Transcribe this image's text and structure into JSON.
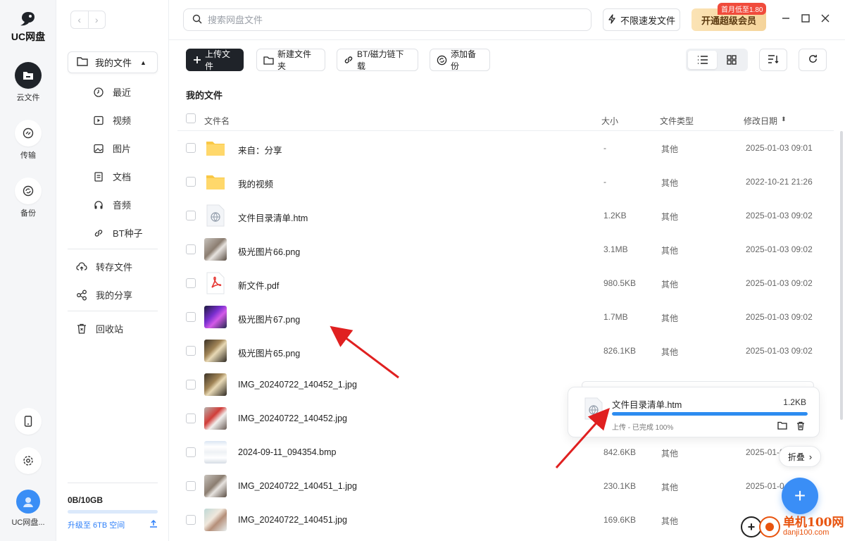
{
  "app": {
    "name": "UC网盘"
  },
  "rail": {
    "items": [
      {
        "label": "云文件"
      },
      {
        "label": "传输"
      },
      {
        "label": "备份"
      }
    ],
    "user_label": "UC网盘..."
  },
  "sidebar": {
    "my_files": "我的文件",
    "categories": [
      {
        "label": "最近"
      },
      {
        "label": "视频"
      },
      {
        "label": "图片"
      },
      {
        "label": "文档"
      },
      {
        "label": "音频"
      },
      {
        "label": "BT种子"
      }
    ],
    "transfer": "转存文件",
    "share": "我的分享",
    "recycle": "回收站",
    "storage": {
      "used": "0B/10GB",
      "upgrade": "升级至 6TB 空间"
    }
  },
  "topbar": {
    "search_placeholder": "搜索网盘文件",
    "fast_download": "不限速发文件",
    "vip_button": "开通超级会员",
    "vip_badge": "首月低至1.80"
  },
  "toolbar": {
    "upload": "上传文件",
    "new_folder": "新建文件夹",
    "bt_magnet": "BT/磁力链下载",
    "add_backup": "添加备份"
  },
  "page_title": "我的文件",
  "table": {
    "headers": {
      "name": "文件名",
      "size": "大小",
      "type": "文件类型",
      "date": "修改日期"
    },
    "rows": [
      {
        "name": "来自：分享",
        "size": "-",
        "type": "其他",
        "date": "2025-01-03 09:01",
        "kind": "folder"
      },
      {
        "name": "我的视频",
        "size": "-",
        "type": "其他",
        "date": "2022-10-21 21:26",
        "kind": "folder"
      },
      {
        "name": "文件目录清单.htm",
        "size": "1.2KB",
        "type": "其他",
        "date": "2025-01-03 09:02",
        "kind": "htm"
      },
      {
        "name": "极光图片66.png",
        "size": "3.1MB",
        "type": "其他",
        "date": "2025-01-03 09:02",
        "kind": "photo-a"
      },
      {
        "name": "新文件.pdf",
        "size": "980.5KB",
        "type": "其他",
        "date": "2025-01-03 09:02",
        "kind": "pdf"
      },
      {
        "name": "极光图片67.png",
        "size": "1.7MB",
        "type": "其他",
        "date": "2025-01-03 09:02",
        "kind": "photo-b"
      },
      {
        "name": "极光图片65.png",
        "size": "826.1KB",
        "type": "其他",
        "date": "2025-01-03 09:02",
        "kind": "photo-c"
      },
      {
        "name": "IMG_20240722_140452_1.jpg",
        "size": "",
        "type": "",
        "date": "",
        "kind": "photo-c"
      },
      {
        "name": "IMG_20240722_140452.jpg",
        "size": "",
        "type": "",
        "date": "",
        "kind": "photo-d"
      },
      {
        "name": "2024-09-11_094354.bmp",
        "size": "842.6KB",
        "type": "其他",
        "date": "2025-01-0",
        "kind": "screenshot"
      },
      {
        "name": "IMG_20240722_140451_1.jpg",
        "size": "230.1KB",
        "type": "其他",
        "date": "2025-01-0",
        "kind": "photo-a"
      },
      {
        "name": "IMG_20240722_140451.jpg",
        "size": "169.6KB",
        "type": "其他",
        "date": "",
        "kind": "photo-e"
      }
    ]
  },
  "upload_popup": {
    "file_name": "文件目录清单.htm",
    "file_size": "1.2KB",
    "status": "上传 - 已完成 100%",
    "progress": 1.0
  },
  "collapse_label": "折叠",
  "watermark": {
    "text_a": "单机100网",
    "text_b": "danji100.com"
  },
  "colors": {
    "accent": "#3a8ef6",
    "dark": "#1f2329",
    "vip": "#f5d49a",
    "arrow": "#e02020"
  }
}
